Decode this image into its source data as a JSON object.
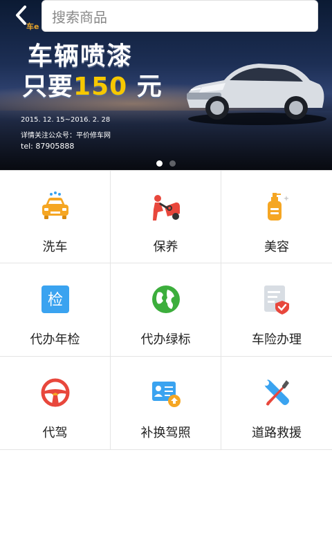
{
  "search": {
    "placeholder": "搜索商品"
  },
  "banner": {
    "brand": "车e",
    "headline_line1": "车辆喷漆",
    "headline_prefix": "只要",
    "headline_price": "150",
    "headline_suffix": " 元",
    "date_range": "2015. 12. 15~2016. 2. 28",
    "follow_text": "详情关注公众号：平价修车网",
    "tel": "tel: 87905888",
    "slide_count": 2,
    "active_slide": 1
  },
  "services": [
    {
      "label": "洗车",
      "icon": "car-wash-icon"
    },
    {
      "label": "保养",
      "icon": "maintenance-icon"
    },
    {
      "label": "美容",
      "icon": "beauty-bottle-icon"
    },
    {
      "label": "代办年检",
      "icon": "annual-inspection-icon"
    },
    {
      "label": "代办绿标",
      "icon": "green-globe-icon"
    },
    {
      "label": "车险办理",
      "icon": "insurance-doc-icon"
    },
    {
      "label": "代驾",
      "icon": "steering-wheel-icon"
    },
    {
      "label": "补换驾照",
      "icon": "license-card-icon"
    },
    {
      "label": "道路救援",
      "icon": "wrench-screwdriver-icon"
    }
  ],
  "inspection_icon_text": "检",
  "colors": {
    "orange": "#f5a623",
    "red": "#e8473c",
    "blue": "#3aa3f0",
    "green": "#3cae3c",
    "price_yellow": "#f6c800"
  }
}
